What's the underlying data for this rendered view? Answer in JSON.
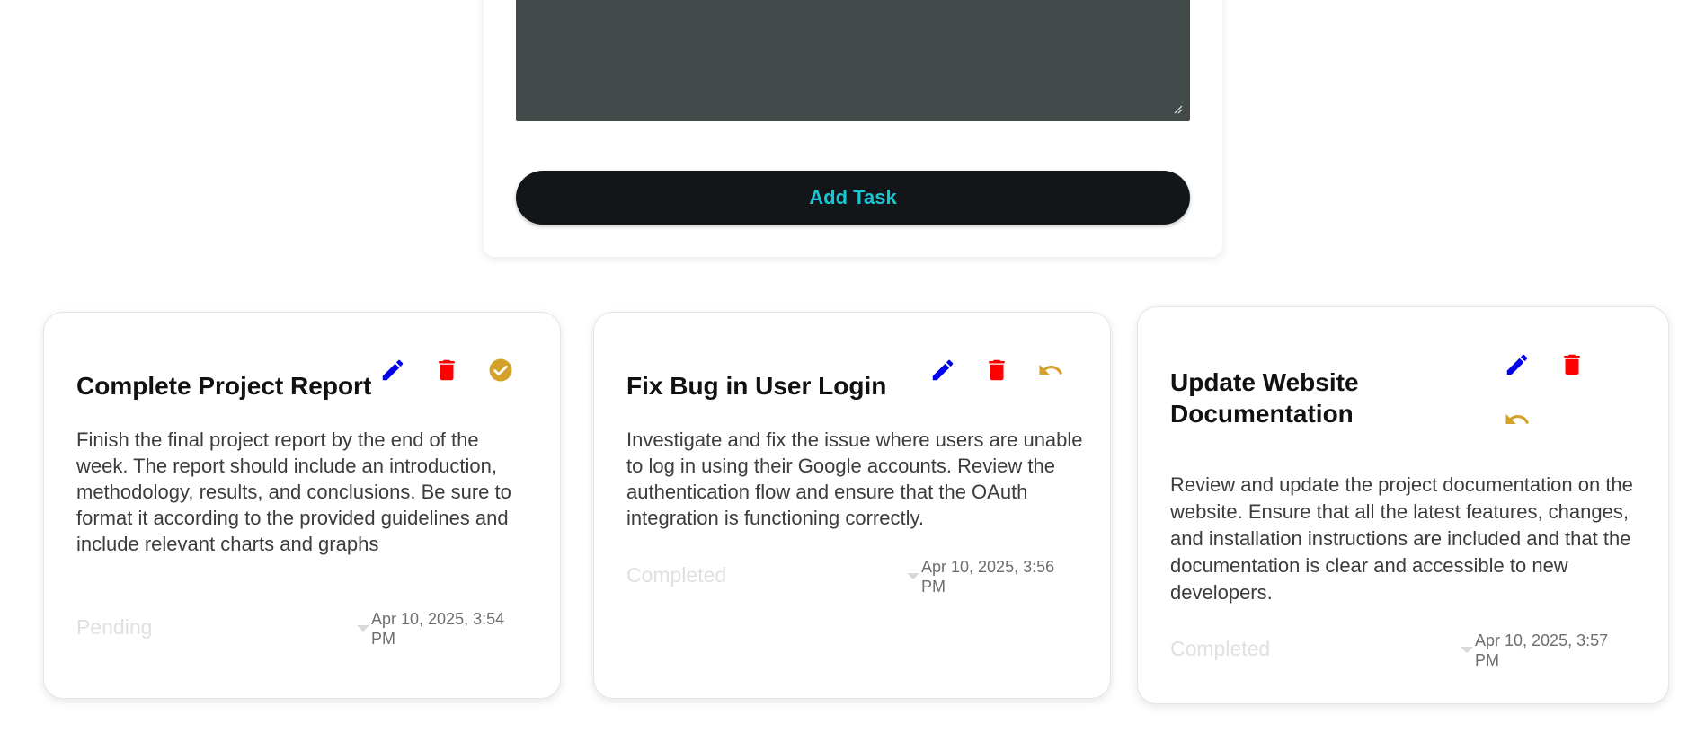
{
  "form": {
    "add_task_label": "Add Task"
  },
  "colors": {
    "edit": "#0000ee",
    "delete": "#ff0000",
    "accent": "#d4a12a",
    "button_text": "#18c7d4"
  },
  "tasks": [
    {
      "title": "Complete Project Report",
      "description": "Finish the final project report by the end of the week. The report should include an introduction, methodology, results, and conclusions. Be sure to format it according to the provided guidelines and include relevant charts and graphs",
      "status": "Pending",
      "date": "Apr 10, 2025, 3:54 PM",
      "icons": [
        "pencil-icon",
        "trash-icon",
        "check-circle-icon"
      ]
    },
    {
      "title": "Fix Bug in User Login",
      "description": "Investigate and fix the issue where users are unable to log in using their Google accounts. Review the authentication flow and ensure that the OAuth integration is functioning correctly.",
      "status": "Completed",
      "date": "Apr 10, 2025, 3:56 PM",
      "icons": [
        "pencil-icon",
        "trash-icon",
        "undo-icon"
      ]
    },
    {
      "title": "Update Website Documentation",
      "description": "Review and update the project documentation on the website. Ensure that all the latest features, changes, and installation instructions are included and that the documentation is clear and accessible to new developers.",
      "status": "Completed",
      "date": "Apr 10, 2025, 3:57 PM",
      "icons": [
        "pencil-icon",
        "trash-icon",
        "undo-icon"
      ]
    }
  ]
}
